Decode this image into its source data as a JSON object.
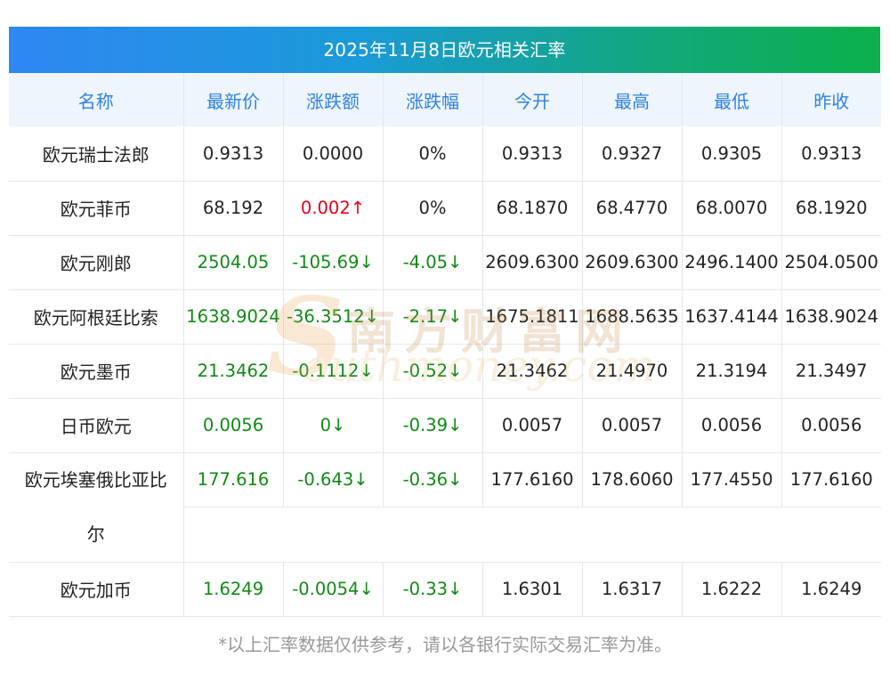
{
  "title": "2025年11月8日欧元相关汇率",
  "headers": [
    "名称",
    "最新价",
    "涨跌额",
    "涨跌幅",
    "今开",
    "最高",
    "最低",
    "昨收"
  ],
  "rows": [
    {
      "name": "欧元瑞士法郎",
      "latest": "0.9313",
      "change": "0.0000",
      "pct": "0%",
      "open": "0.9313",
      "high": "0.9327",
      "low": "0.9305",
      "prev": "0.9313",
      "dir": "flat"
    },
    {
      "name": "欧元菲币",
      "latest": "68.192",
      "change": "0.002↑",
      "pct": "0%",
      "open": "68.1870",
      "high": "68.4770",
      "low": "68.0070",
      "prev": "68.1920",
      "dir": "up"
    },
    {
      "name": "欧元刚郎",
      "latest": "2504.05",
      "change": "-105.69↓",
      "pct": "-4.05↓",
      "open": "2609.6300",
      "high": "2609.6300",
      "low": "2496.1400",
      "prev": "2504.0500",
      "dir": "down"
    },
    {
      "name": "欧元阿根廷比索",
      "latest": "1638.9024",
      "change": "-36.3512↓",
      "pct": "-2.17↓",
      "open": "1675.1811",
      "high": "1688.5635",
      "low": "1637.4144",
      "prev": "1638.9024",
      "dir": "down"
    },
    {
      "name": "欧元墨币",
      "latest": "21.3462",
      "change": "-0.1112↓",
      "pct": "-0.52↓",
      "open": "21.3462",
      "high": "21.4970",
      "low": "21.3194",
      "prev": "21.3497",
      "dir": "down"
    },
    {
      "name": "日币欧元",
      "latest": "0.0056",
      "change": "0↓",
      "pct": "-0.39↓",
      "open": "0.0057",
      "high": "0.0057",
      "low": "0.0056",
      "prev": "0.0056",
      "dir": "down"
    },
    {
      "name": "欧元埃塞俄比亚比尔",
      "latest": "177.616",
      "change": "-0.643↓",
      "pct": "-0.36↓",
      "open": "177.6160",
      "high": "178.6060",
      "low": "177.4550",
      "prev": "177.6160",
      "dir": "down"
    },
    {
      "name": "欧元加币",
      "latest": "1.6249",
      "change": "-0.0054↓",
      "pct": "-0.33↓",
      "open": "1.6301",
      "high": "1.6317",
      "low": "1.6222",
      "prev": "1.6249",
      "dir": "down"
    }
  ],
  "name_wrap": {
    "line1": "欧元埃塞俄比亚比",
    "line2": "尔"
  },
  "watermark": {
    "cn": "南方财富网",
    "en": "outhmoney.com",
    "s": "S"
  },
  "footnote": "*以上汇率数据仅供参考，请以各银行实际交易汇率为准。",
  "colors": {
    "up": "#e60012",
    "down": "#0f8a14",
    "header_text": "#2f82e0",
    "header_bg": "#eef5fc"
  }
}
